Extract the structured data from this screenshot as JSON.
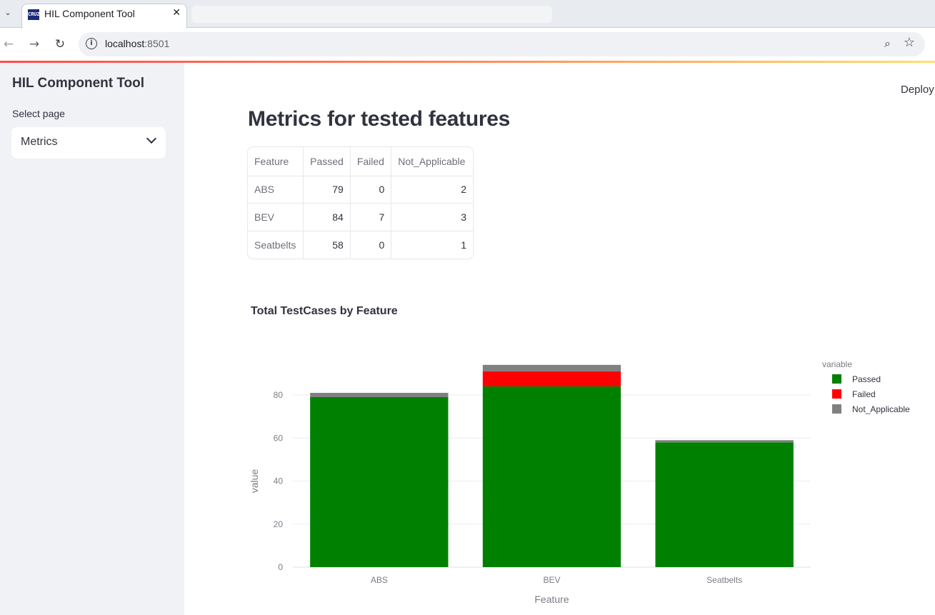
{
  "browser": {
    "tab_title": "HIL Component Tool",
    "favicon_text": "CRUZ",
    "url_host": "localhost",
    "url_port": ":8501"
  },
  "app": {
    "deploy_label": "Deploy",
    "sidebar": {
      "title": "HIL Component Tool",
      "select_label": "Select page",
      "select_value": "Metrics"
    },
    "page_title": "Metrics for tested features",
    "table": {
      "columns": [
        "Feature",
        "Passed",
        "Failed",
        "Not_Applicable"
      ],
      "rows": [
        [
          "ABS",
          "79",
          "0",
          "2"
        ],
        [
          "BEV",
          "84",
          "7",
          "3"
        ],
        [
          "Seatbelts",
          "58",
          "0",
          "1"
        ]
      ]
    }
  },
  "chart_data": {
    "type": "bar",
    "stacked": true,
    "title": "Total TestCases by Feature",
    "xlabel": "Feature",
    "ylabel": "value",
    "categories": [
      "ABS",
      "BEV",
      "Seatbelts"
    ],
    "series": [
      {
        "name": "Passed",
        "values": [
          79,
          84,
          58
        ],
        "color": "#008000"
      },
      {
        "name": "Failed",
        "values": [
          0,
          7,
          0
        ],
        "color": "#ff0000"
      },
      {
        "name": "Not_Applicable",
        "values": [
          2,
          3,
          1
        ],
        "color": "#808080"
      }
    ],
    "yticks": [
      0,
      20,
      40,
      60,
      80
    ],
    "ylim": [
      0,
      94
    ],
    "legend_title": "variable",
    "legend_position": "top-right",
    "grid": true
  }
}
